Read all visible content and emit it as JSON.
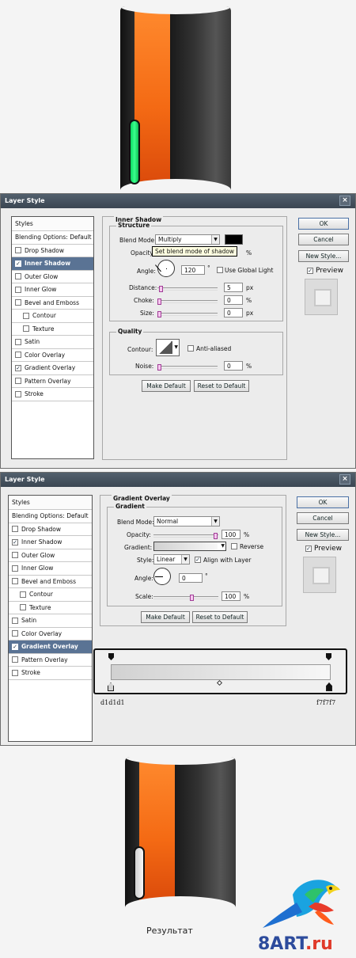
{
  "top_window": {
    "title": "Layer Style",
    "close_label": "×",
    "sidebar": [
      {
        "label": "Styles",
        "checkbox": false,
        "checked": false,
        "active": false
      },
      {
        "label": "Blending Options: Default",
        "checkbox": false,
        "checked": false,
        "active": false
      },
      {
        "label": "Drop Shadow",
        "checkbox": true,
        "checked": false,
        "active": false
      },
      {
        "label": "Inner Shadow",
        "checkbox": true,
        "checked": true,
        "active": true
      },
      {
        "label": "Outer Glow",
        "checkbox": true,
        "checked": false,
        "active": false
      },
      {
        "label": "Inner Glow",
        "checkbox": true,
        "checked": false,
        "active": false
      },
      {
        "label": "Bevel and Emboss",
        "checkbox": true,
        "checked": false,
        "active": false
      },
      {
        "label": "Contour",
        "checkbox": true,
        "checked": false,
        "active": false,
        "sub": true
      },
      {
        "label": "Texture",
        "checkbox": true,
        "checked": false,
        "active": false,
        "sub": true
      },
      {
        "label": "Satin",
        "checkbox": true,
        "checked": false,
        "active": false
      },
      {
        "label": "Color Overlay",
        "checkbox": true,
        "checked": false,
        "active": false
      },
      {
        "label": "Gradient Overlay",
        "checkbox": true,
        "checked": true,
        "active": false
      },
      {
        "label": "Pattern Overlay",
        "checkbox": true,
        "checked": false,
        "active": false
      },
      {
        "label": "Stroke",
        "checkbox": true,
        "checked": false,
        "active": false
      }
    ],
    "panel_title": "Inner Shadow",
    "structure_title": "Structure",
    "blend_mode_label": "Blend Mode:",
    "blend_mode_value": "Multiply",
    "opacity_label": "Opacity:",
    "opacity_unit": "%",
    "tooltip": "Set blend mode of shadow",
    "angle_label": "Angle:",
    "angle_value": "120",
    "angle_unit": "°",
    "use_global_light": "Use Global Light",
    "distance_label": "Distance:",
    "distance_value": "5",
    "distance_unit": "px",
    "choke_label": "Choke:",
    "choke_value": "0",
    "choke_unit": "%",
    "size_label": "Size:",
    "size_value": "0",
    "size_unit": "px",
    "quality_title": "Quality",
    "contour_label": "Contour:",
    "anti_aliased": "Anti-aliased",
    "noise_label": "Noise:",
    "noise_value": "0",
    "noise_unit": "%",
    "make_default": "Make Default",
    "reset_default": "Reset to Default",
    "ok": "OK",
    "cancel": "Cancel",
    "new_style": "New Style...",
    "preview": "Preview",
    "shadow_color": "#000000"
  },
  "bottom_window": {
    "title": "Layer Style",
    "close_label": "×",
    "sidebar": [
      {
        "label": "Styles",
        "checkbox": false,
        "checked": false,
        "active": false
      },
      {
        "label": "Blending Options: Default",
        "checkbox": false,
        "checked": false,
        "active": false
      },
      {
        "label": "Drop Shadow",
        "checkbox": true,
        "checked": false,
        "active": false
      },
      {
        "label": "Inner Shadow",
        "checkbox": true,
        "checked": true,
        "active": false
      },
      {
        "label": "Outer Glow",
        "checkbox": true,
        "checked": false,
        "active": false
      },
      {
        "label": "Inner Glow",
        "checkbox": true,
        "checked": false,
        "active": false
      },
      {
        "label": "Bevel and Emboss",
        "checkbox": true,
        "checked": false,
        "active": false
      },
      {
        "label": "Contour",
        "checkbox": true,
        "checked": false,
        "active": false,
        "sub": true
      },
      {
        "label": "Texture",
        "checkbox": true,
        "checked": false,
        "active": false,
        "sub": true
      },
      {
        "label": "Satin",
        "checkbox": true,
        "checked": false,
        "active": false
      },
      {
        "label": "Color Overlay",
        "checkbox": true,
        "checked": false,
        "active": false
      },
      {
        "label": "Gradient Overlay",
        "checkbox": true,
        "checked": true,
        "active": true
      },
      {
        "label": "Pattern Overlay",
        "checkbox": true,
        "checked": false,
        "active": false
      },
      {
        "label": "Stroke",
        "checkbox": true,
        "checked": false,
        "active": false
      }
    ],
    "panel_title": "Gradient Overlay",
    "gradient_title": "Gradient",
    "blend_mode_label": "Blend Mode:",
    "blend_mode_value": "Normal",
    "opacity_label": "Opacity:",
    "opacity_value": "100",
    "opacity_unit": "%",
    "gradient_label": "Gradient:",
    "reverse": "Reverse",
    "style_label": "Style:",
    "style_value": "Linear",
    "align_with_layer": "Align with Layer",
    "angle_label": "Angle:",
    "angle_value": "0",
    "angle_unit": "°",
    "scale_label": "Scale:",
    "scale_value": "100",
    "scale_unit": "%",
    "make_default": "Make Default",
    "reset_default": "Reset to Default",
    "ok": "OK",
    "cancel": "Cancel",
    "new_style": "New Style...",
    "preview": "Preview",
    "gradient_start": "#d1d1d1",
    "gradient_end": "#f7f7f7",
    "stop_left_label": "d1d1d1",
    "stop_right_label": "f7f7f7"
  },
  "caption": "Результат",
  "logo": {
    "prefix": "8ART",
    "suffix": ".ru"
  }
}
